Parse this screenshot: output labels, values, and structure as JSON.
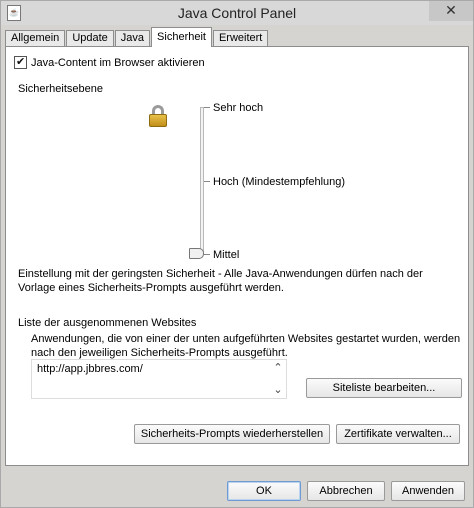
{
  "window": {
    "title": "Java Control Panel",
    "close_glyph": "✕",
    "app_icon_glyph": "☕"
  },
  "tabs": [
    {
      "label": "Allgemein",
      "active": false
    },
    {
      "label": "Update",
      "active": false
    },
    {
      "label": "Java",
      "active": false
    },
    {
      "label": "Sicherheit",
      "active": true
    },
    {
      "label": "Erweitert",
      "active": false
    }
  ],
  "security": {
    "enable_java_label": "Java-Content im Browser aktivieren",
    "enable_java_checked": true,
    "level_heading": "Sicherheitsebene",
    "levels": {
      "very_high": "Sehr hoch",
      "high": "Hoch (Mindestempfehlung)",
      "medium": "Mittel"
    },
    "selected_level": "Mittel",
    "level_description": "Einstellung mit der geringsten Sicherheit - Alle Java-Anwendungen dürfen nach der Vorlage eines Sicherheits-Prompts ausgeführt werden."
  },
  "exceptions": {
    "title": "Liste der ausgenommenen Websites",
    "description": "Anwendungen, die von einer der unten aufgeführten Websites gestartet wurden, werden nach den jeweiligen Sicherheits-Prompts ausgeführt.",
    "sites": [
      "http://app.jbbres.com/"
    ],
    "edit_button": "Siteliste bearbeiten..."
  },
  "actions": {
    "restore_prompts": "Sicherheits-Prompts wiederherstellen",
    "manage_certs": "Zertifikate verwalten..."
  },
  "dialog": {
    "ok": "OK",
    "cancel": "Abbrechen",
    "apply": "Anwenden"
  },
  "colors": {
    "window_bg": "#d5d4d0",
    "panel_bg": "#ffffff",
    "focus_border": "#6f9bd5"
  }
}
